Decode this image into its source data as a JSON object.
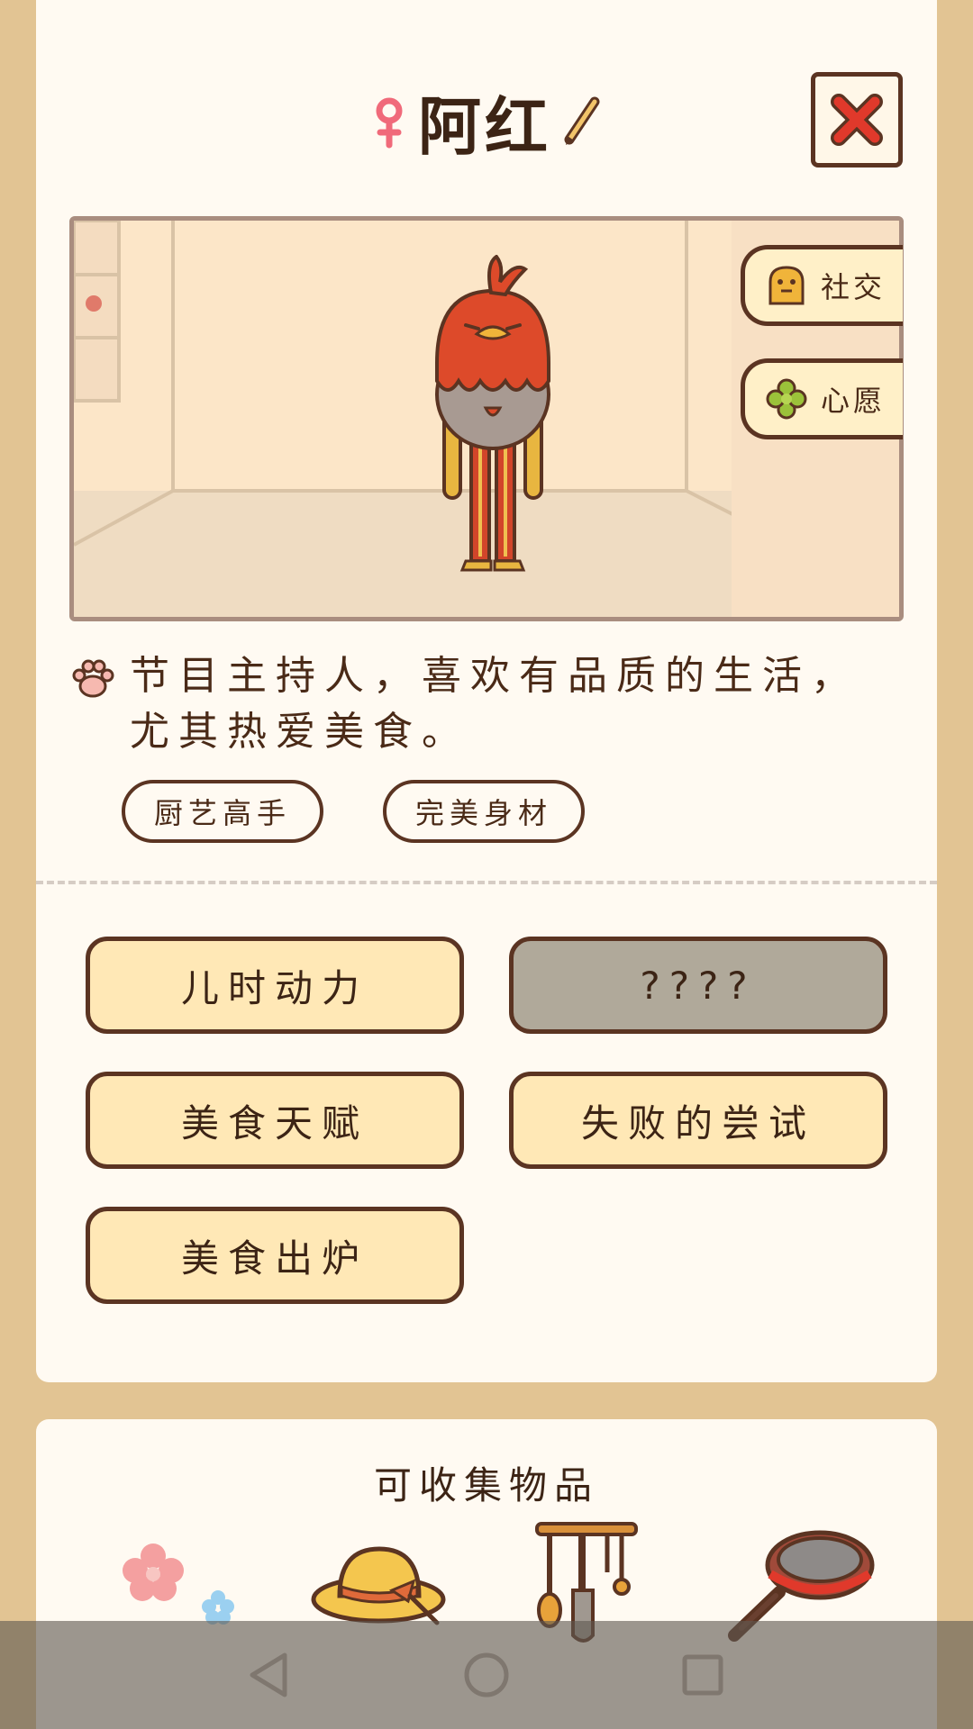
{
  "character": {
    "name": "阿红",
    "gender_icon": "female-symbol-icon",
    "description": "节目主持人，喜欢有品质的生活，尤其热爱美食。",
    "tags": [
      "厨艺高手",
      "完美身材"
    ]
  },
  "side_buttons": [
    {
      "label": "社交",
      "icon": "social-face-icon"
    },
    {
      "label": "心愿",
      "icon": "clover-icon"
    }
  ],
  "stories": [
    {
      "label": "儿时动力",
      "locked": false
    },
    {
      "label": "????",
      "locked": true
    },
    {
      "label": "美食天赋",
      "locked": false
    },
    {
      "label": "失败的尝试",
      "locked": false
    },
    {
      "label": "美食出炉",
      "locked": false
    }
  ],
  "collectibles": {
    "title": "可收集物品",
    "items": [
      "flower-icon",
      "straw-hat-icon",
      "utensil-rack-icon",
      "frying-pan-icon"
    ]
  },
  "colors": {
    "background": "#e2c493",
    "card": "#fffaf2",
    "button_fill": "#ffe8b6",
    "button_locked": "#b0a99a",
    "outline": "#5b3422",
    "close_x": "#e0392b",
    "chicken_red": "#dd4a2a"
  },
  "nav": [
    "back-icon",
    "home-icon",
    "recents-icon"
  ]
}
